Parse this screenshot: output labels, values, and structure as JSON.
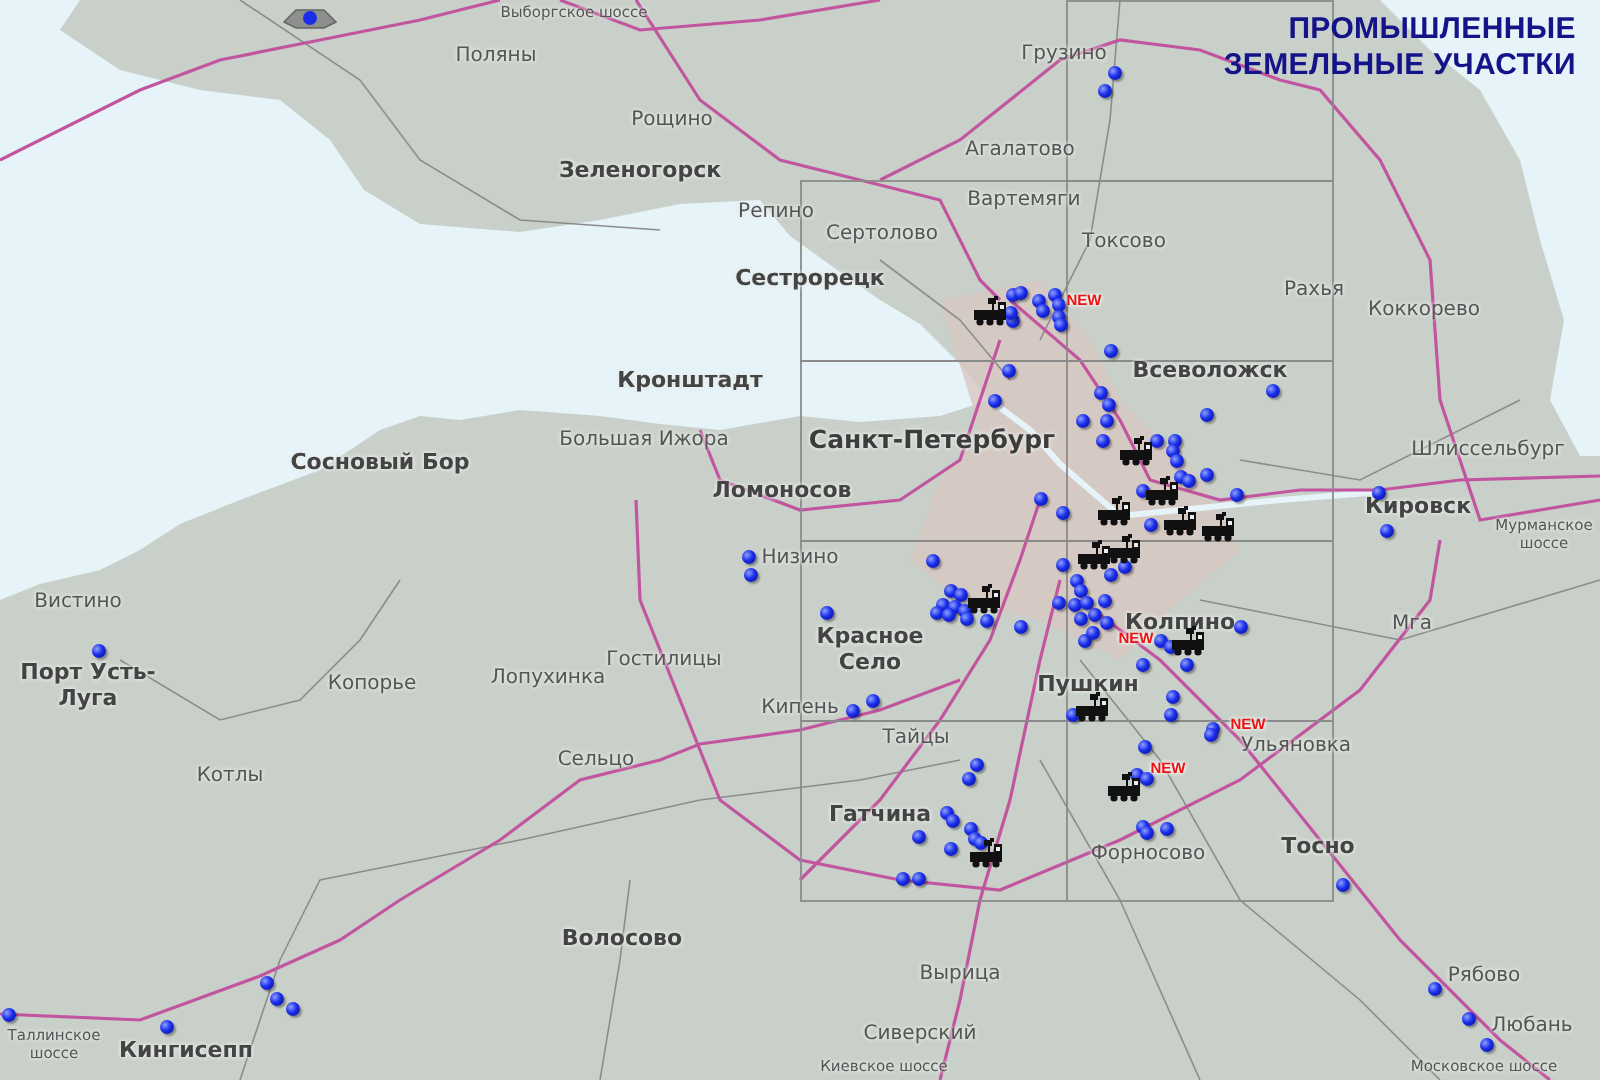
{
  "title": {
    "lines": [
      "ПРОМЫШЛЕННЫЕ",
      "ЗЕМЕЛЬНЫЕ УЧАСТКИ"
    ]
  },
  "places": [
    {
      "name": "Выборгское шоссе",
      "kind": "road"
    },
    {
      "name": "Поляны",
      "kind": "town"
    },
    {
      "name": "Грузино",
      "kind": "town"
    },
    {
      "name": "Рощино",
      "kind": "town"
    },
    {
      "name": "Агалатово",
      "kind": "town"
    },
    {
      "name": "Зеленогорск",
      "kind": "city"
    },
    {
      "name": "Вартемяги",
      "kind": "town"
    },
    {
      "name": "Репино",
      "kind": "town"
    },
    {
      "name": "Сертолово",
      "kind": "town"
    },
    {
      "name": "Токсово",
      "kind": "town"
    },
    {
      "name": "Сестрорецк",
      "kind": "city"
    },
    {
      "name": "Рахья",
      "kind": "town"
    },
    {
      "name": "Коккорево",
      "kind": "town"
    },
    {
      "name": "Всеволожск",
      "kind": "city"
    },
    {
      "name": "Кронштадт",
      "kind": "city"
    },
    {
      "name": "Большая Ижора",
      "kind": "town"
    },
    {
      "name": "Санкт-Петербург",
      "kind": "capital"
    },
    {
      "name": "Шлиссельбург",
      "kind": "town"
    },
    {
      "name": "Сосновый Бор",
      "kind": "city"
    },
    {
      "name": "Ломоносов",
      "kind": "city"
    },
    {
      "name": "Кировск",
      "kind": "city"
    },
    {
      "name": "Мурманское шоссе",
      "kind": "road"
    },
    {
      "name": "Низино",
      "kind": "town"
    },
    {
      "name": "Вистино",
      "kind": "town"
    },
    {
      "name": "Колпино",
      "kind": "city"
    },
    {
      "name": "Мга",
      "kind": "town"
    },
    {
      "name": "Красное Село",
      "kind": "city"
    },
    {
      "name": "Копорье",
      "kind": "town"
    },
    {
      "name": "Лопухинка",
      "kind": "town"
    },
    {
      "name": "Гостилицы",
      "kind": "town"
    },
    {
      "name": "Порт Усть-Луга",
      "kind": "city"
    },
    {
      "name": "Пушкин",
      "kind": "city"
    },
    {
      "name": "Кипень",
      "kind": "town"
    },
    {
      "name": "Тайцы",
      "kind": "town"
    },
    {
      "name": "Ульяновка",
      "kind": "town"
    },
    {
      "name": "Котлы",
      "kind": "town"
    },
    {
      "name": "Сельцо",
      "kind": "town"
    },
    {
      "name": "Гатчина",
      "kind": "city"
    },
    {
      "name": "Форносово",
      "kind": "town"
    },
    {
      "name": "Тосно",
      "kind": "city"
    },
    {
      "name": "Волосово",
      "kind": "city"
    },
    {
      "name": "Вырица",
      "kind": "town"
    },
    {
      "name": "Рябово",
      "kind": "town"
    },
    {
      "name": "Таллинское шоссе",
      "kind": "road"
    },
    {
      "name": "Кингисепп",
      "kind": "city"
    },
    {
      "name": "Сиверский",
      "kind": "town"
    },
    {
      "name": "Любань",
      "kind": "town"
    },
    {
      "name": "Киевское шоссе",
      "kind": "road"
    },
    {
      "name": "Московское шоссе",
      "kind": "road"
    }
  ],
  "badges": [
    "NEW",
    "NEW",
    "NEW",
    "NEW"
  ]
}
